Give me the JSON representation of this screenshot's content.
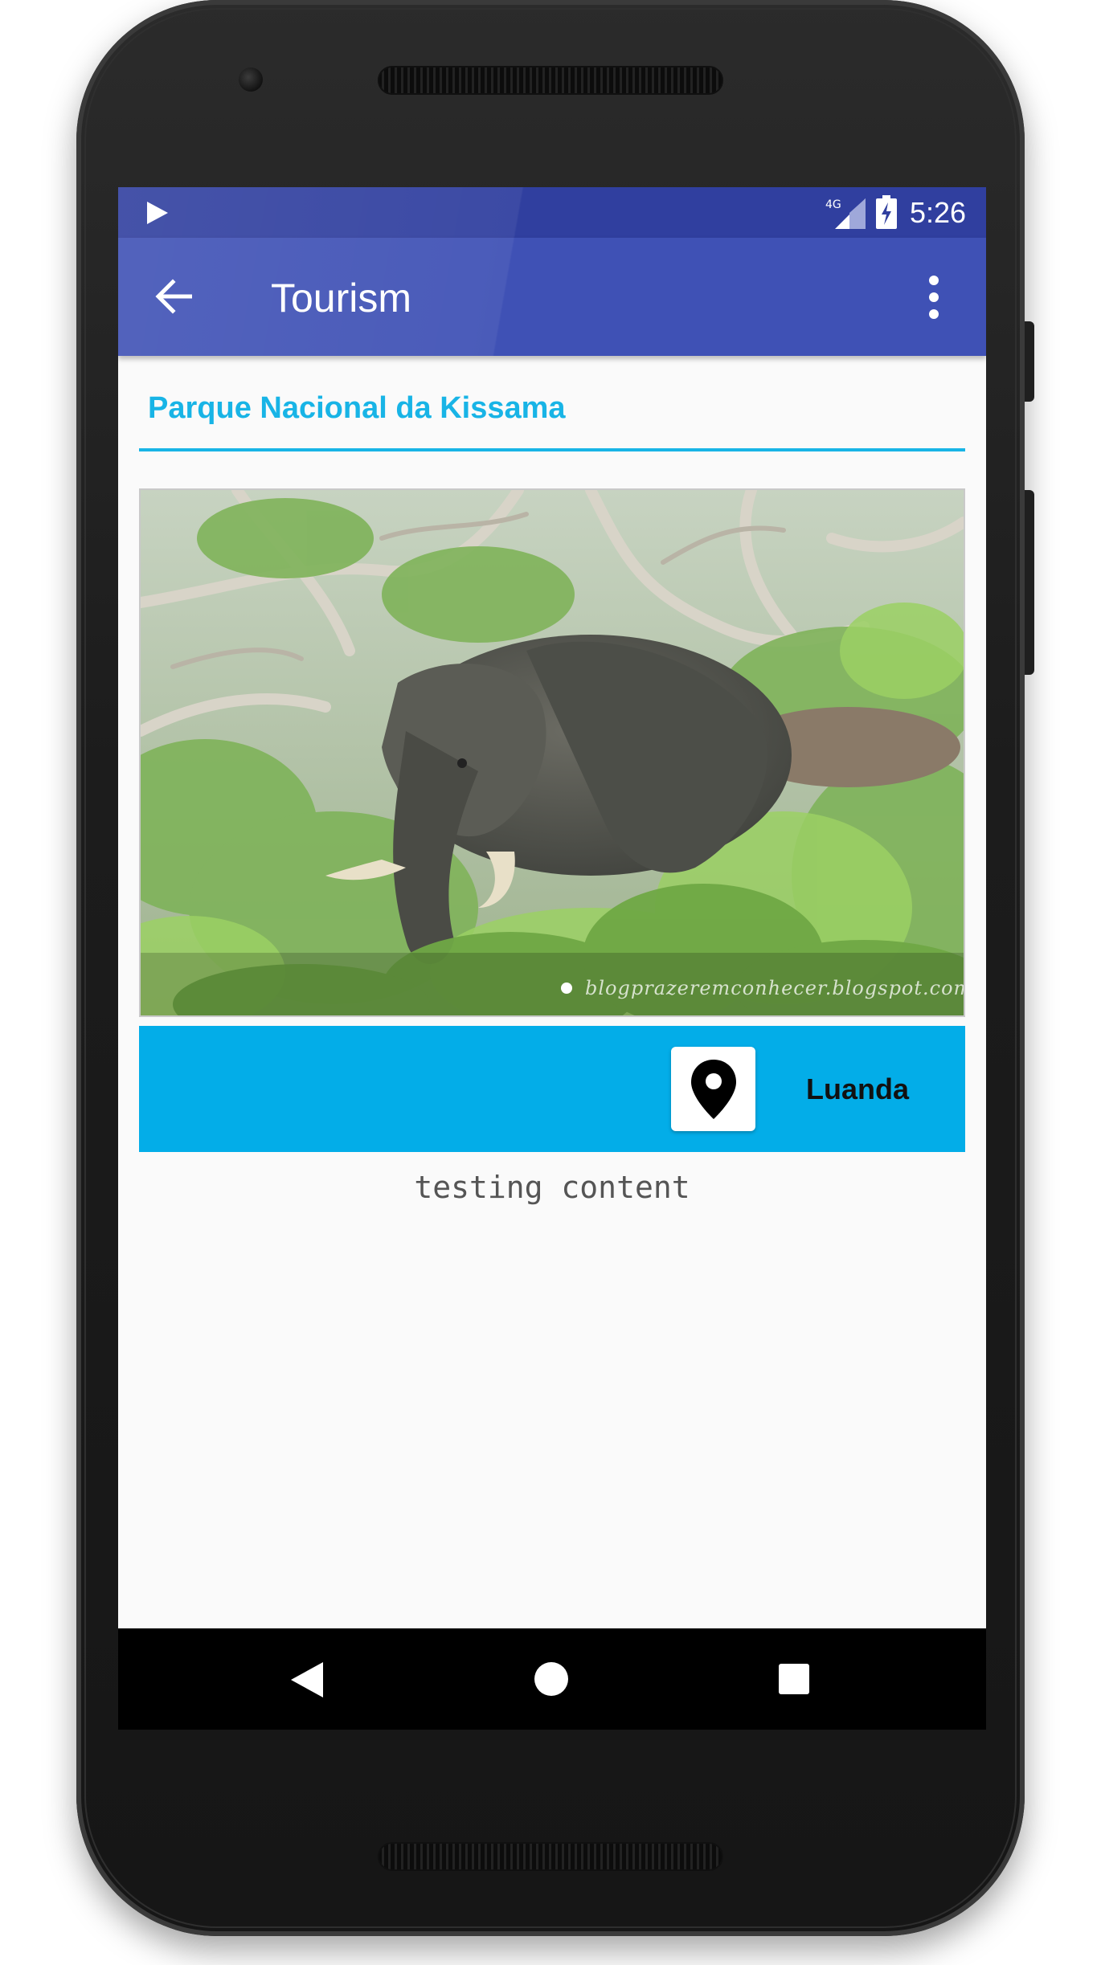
{
  "status_bar": {
    "time": "5:26",
    "network": "4G",
    "media_icon": "play-icon",
    "signal_icon": "signal-icon",
    "battery_icon": "battery-charging-icon"
  },
  "app_bar": {
    "title": "Tourism",
    "back_icon": "arrow-back-icon",
    "menu_icon": "more-vert-icon",
    "color": "#3f51b5",
    "status_color": "#303f9f"
  },
  "place": {
    "name": "Parque Nacional da Kissama",
    "accent_color": "#18b4e6",
    "image": {
      "subject": "elephant",
      "watermark": "blogprazeremconhecer.blogspot.com",
      "active_slide": 1,
      "slide_count": 1
    },
    "location": {
      "label": "Luanda",
      "icon": "location-pin-icon",
      "bar_color": "#03ade8"
    },
    "content": "testing content"
  },
  "nav_bar": {
    "back_icon": "nav-back-icon",
    "home_icon": "nav-home-icon",
    "recents_icon": "nav-recents-icon"
  }
}
